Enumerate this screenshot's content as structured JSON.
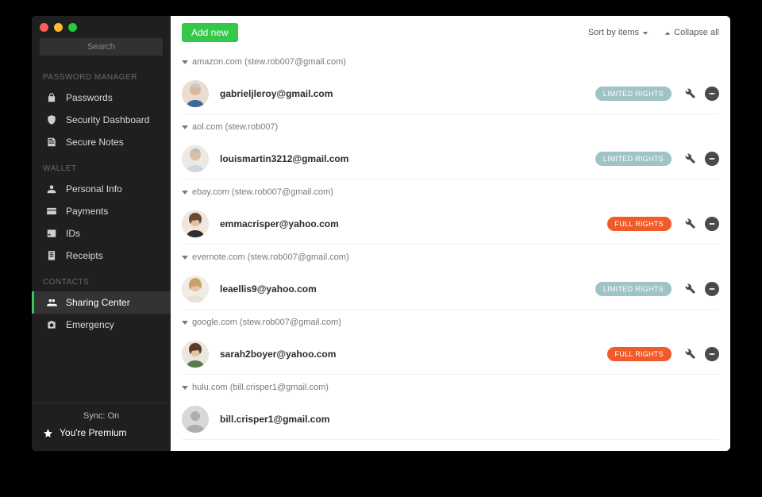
{
  "sidebar": {
    "search_placeholder": "Search",
    "sections": {
      "password_manager": {
        "label": "PASSWORD MANAGER",
        "items": [
          {
            "label": "Passwords",
            "icon": "lock"
          },
          {
            "label": "Security Dashboard",
            "icon": "shield"
          },
          {
            "label": "Secure Notes",
            "icon": "note"
          }
        ]
      },
      "wallet": {
        "label": "WALLET",
        "items": [
          {
            "label": "Personal Info",
            "icon": "person"
          },
          {
            "label": "Payments",
            "icon": "card"
          },
          {
            "label": "IDs",
            "icon": "id"
          },
          {
            "label": "Receipts",
            "icon": "receipt"
          }
        ]
      },
      "contacts": {
        "label": "CONTACTS",
        "items": [
          {
            "label": "Sharing Center",
            "icon": "share",
            "active": true
          },
          {
            "label": "Emergency",
            "icon": "emergency"
          }
        ]
      }
    },
    "footer": {
      "sync": "Sync: On",
      "premium": "You're Premium"
    }
  },
  "toolbar": {
    "add_new": "Add new",
    "sort_by": "Sort by items",
    "collapse_all": "Collapse all"
  },
  "rights_labels": {
    "limited": "LIMITED RIGHTS",
    "full": "FULL RIGHTS"
  },
  "shares": [
    {
      "header": "amazon.com (stew.rob007@gmail.com)",
      "contact": {
        "email": "gabrieljleroy@gmail.com",
        "rights": "limited",
        "avatar": 1
      }
    },
    {
      "header": "aol.com (stew.rob007)",
      "contact": {
        "email": "louismartin3212@gmail.com",
        "rights": "limited",
        "avatar": 2
      }
    },
    {
      "header": "ebay.com (stew.rob007@gmail.com)",
      "contact": {
        "email": "emmacrisper@yahoo.com",
        "rights": "full",
        "avatar": 3
      }
    },
    {
      "header": "evernote.com (stew.rob007@gmail.com)",
      "contact": {
        "email": "leaellis9@yahoo.com",
        "rights": "limited",
        "avatar": 4
      }
    },
    {
      "header": "google.com (stew.rob007@gmail.com)",
      "contact": {
        "email": "sarah2boyer@yahoo.com",
        "rights": "full",
        "avatar": 5
      }
    },
    {
      "header": "hulu.com (bill.crisper1@gmail.com)",
      "contact": {
        "email": "bill.crisper1@gmail.com",
        "rights": "none",
        "avatar": 0
      }
    }
  ]
}
